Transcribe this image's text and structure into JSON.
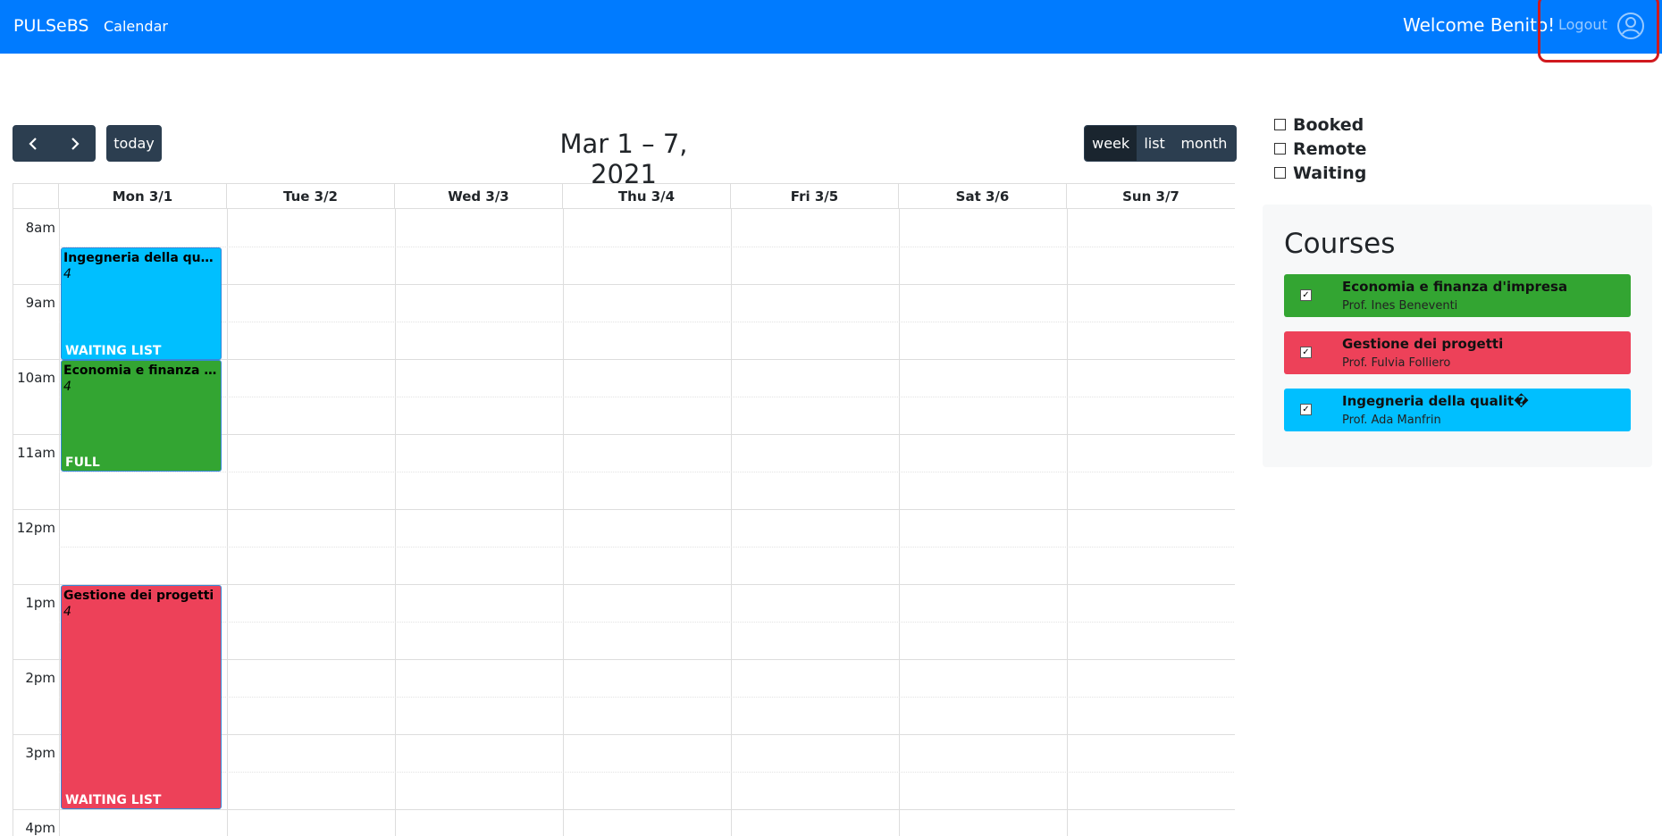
{
  "navbar": {
    "brand": "PULSeBS",
    "calendar_link": "Calendar",
    "welcome": "Welcome Benito!",
    "logout": "Logout",
    "avatar_icon": "user-circle-icon",
    "highlight_color": "#d0191e"
  },
  "toolbar": {
    "prev_icon": "‹",
    "next_icon": "›",
    "today": "today",
    "title": "Mar 1 – 7, 2021",
    "views": [
      "week",
      "list",
      "month"
    ],
    "active_view": "week"
  },
  "calendar": {
    "days": [
      "Mon 3/1",
      "Tue 3/2",
      "Wed 3/3",
      "Thu 3/4",
      "Fri 3/5",
      "Sat 3/6",
      "Sun 3/7"
    ],
    "times": [
      "8am",
      "9am",
      "10am",
      "11am",
      "12pm",
      "1pm",
      "2pm",
      "3pm",
      "4pm"
    ],
    "events": [
      {
        "title": "Ingegneria della qualit�",
        "count": "4",
        "status": "WAITING LIST",
        "color": "#00bfff"
      },
      {
        "title": "Economia e finanza d'impresa",
        "count": "4",
        "status": "FULL",
        "color": "#33a532"
      },
      {
        "title": "Gestione dei progetti",
        "count": "4",
        "status": "WAITING LIST",
        "color": "#ed4159"
      }
    ]
  },
  "filters": [
    "Booked",
    "Remote",
    "Waiting"
  ],
  "courses": {
    "heading": "Courses",
    "items": [
      {
        "name": "Economia e finanza d'impresa",
        "prof": "Prof. Ines Beneventi",
        "color": "#33a532",
        "checked": true
      },
      {
        "name": "Gestione dei progetti",
        "prof": "Prof. Fulvia Folliero",
        "color": "#ed4159",
        "checked": true
      },
      {
        "name": "Ingegneria della qualit�",
        "prof": "Prof. Ada Manfrin",
        "color": "#00bfff",
        "checked": true
      }
    ]
  }
}
